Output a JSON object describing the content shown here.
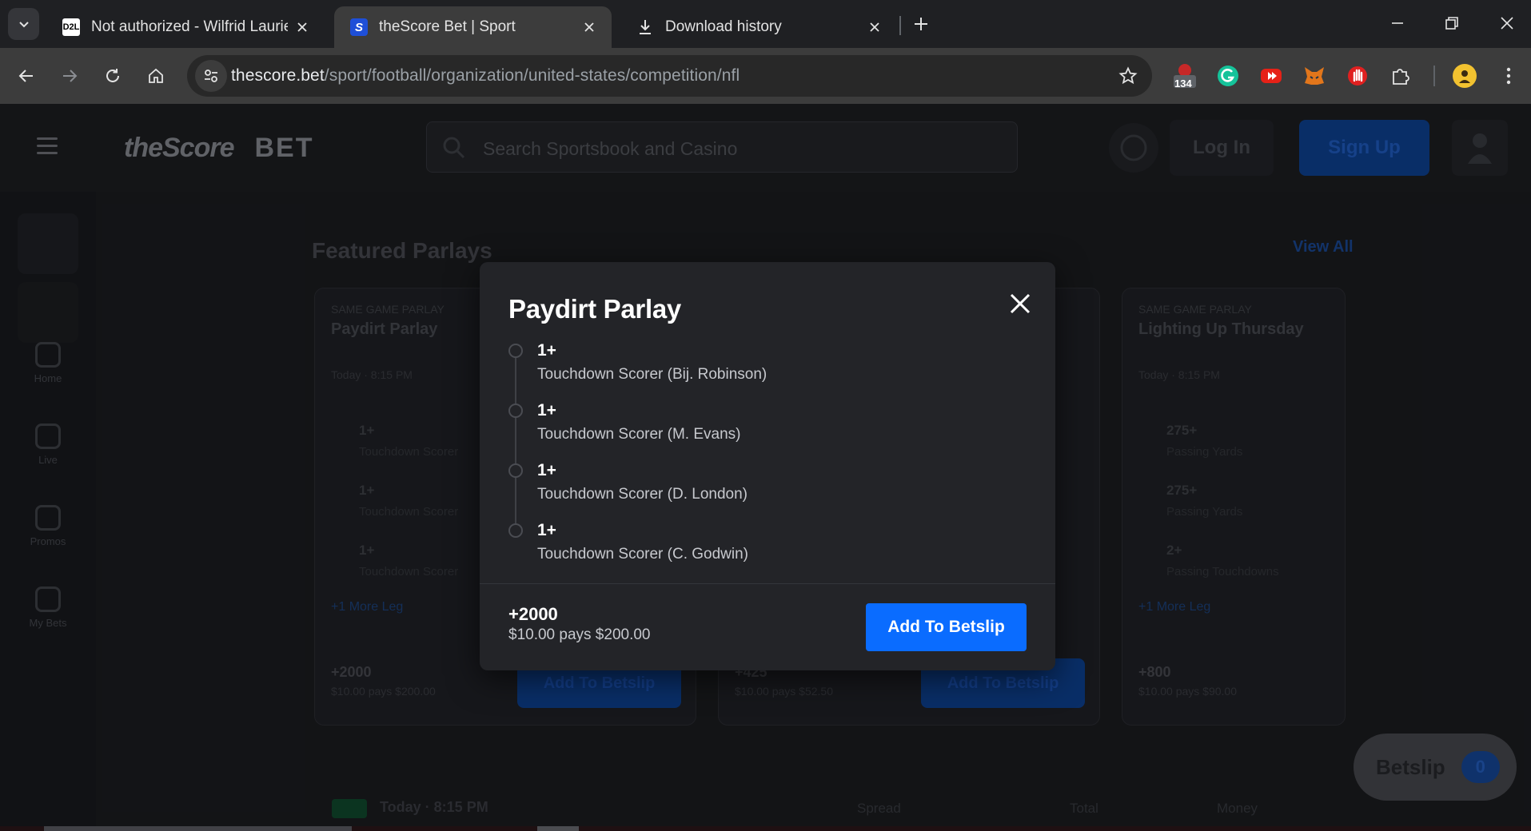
{
  "browser": {
    "tabs": [
      {
        "title": "Not authorized - Wilfrid Laurier",
        "favicon": "D2L"
      },
      {
        "title": "theScore Bet | Sport",
        "favicon": "S"
      },
      {
        "title": "Download history"
      }
    ],
    "url_host": "thescore.bet",
    "url_path": "/sport/football/organization/united-states/competition/nfl",
    "extension_badge": "134"
  },
  "site": {
    "logo_text": "theScore",
    "logo_bet": "BET",
    "search_placeholder": "Search Sportsbook and Casino",
    "login_label": "Log In",
    "signup_label": "Sign Up",
    "sidebar_nav": [
      "Home",
      "Live",
      "Promos",
      "My Bets"
    ],
    "section_title": "Featured Parlays",
    "view_all": "View All",
    "cards": [
      {
        "kicker": "SAME GAME PARLAY",
        "name": "Paydirt Parlay",
        "time": "Today · 8:15 PM",
        "legs": [
          {
            "value": "1+",
            "desc": "Touchdown Scorer"
          },
          {
            "value": "1+",
            "desc": "Touchdown Scorer"
          },
          {
            "value": "1+",
            "desc": "Touchdown Scorer"
          }
        ],
        "more": "+1 More Leg",
        "odds": "+2000",
        "pays": "$10.00 pays $200.00",
        "button": "Add To Betslip"
      },
      {
        "kicker": "",
        "name": "",
        "time": "",
        "legs": [],
        "more": "",
        "odds": "+425",
        "pays": "$10.00 pays $52.50",
        "button": "Add To Betslip"
      },
      {
        "kicker": "SAME GAME PARLAY",
        "name": "Lighting Up Thursday",
        "time": "Today · 8:15 PM",
        "legs": [
          {
            "value": "275+",
            "desc": "Passing Yards"
          },
          {
            "value": "275+",
            "desc": "Passing Yards"
          },
          {
            "value": "2+",
            "desc": "Passing Touchdowns"
          }
        ],
        "more": "+1 More Leg",
        "odds": "+800",
        "pays": "$10.00 pays $90.00",
        "button": "Add To Betslip"
      }
    ],
    "betslip_label": "Betslip",
    "betslip_count": "0",
    "game_row": {
      "date": "Today · 8:15 PM",
      "cols": [
        "Spread",
        "Total",
        "Money"
      ]
    }
  },
  "modal": {
    "title": "Paydirt Parlay",
    "legs": [
      {
        "value": "1+",
        "desc": "Touchdown Scorer (Bij. Robinson)"
      },
      {
        "value": "1+",
        "desc": "Touchdown Scorer (M. Evans)"
      },
      {
        "value": "1+",
        "desc": "Touchdown Scorer (D. London)"
      },
      {
        "value": "1+",
        "desc": "Touchdown Scorer (C. Godwin)"
      }
    ],
    "odds": "+2000",
    "pays": "$10.00 pays $200.00",
    "button_label": "Add To Betslip"
  },
  "colors": {
    "accent_blue": "#0a6cff",
    "modal_bg": "#232428",
    "chrome_bg": "#3c3c3c"
  }
}
